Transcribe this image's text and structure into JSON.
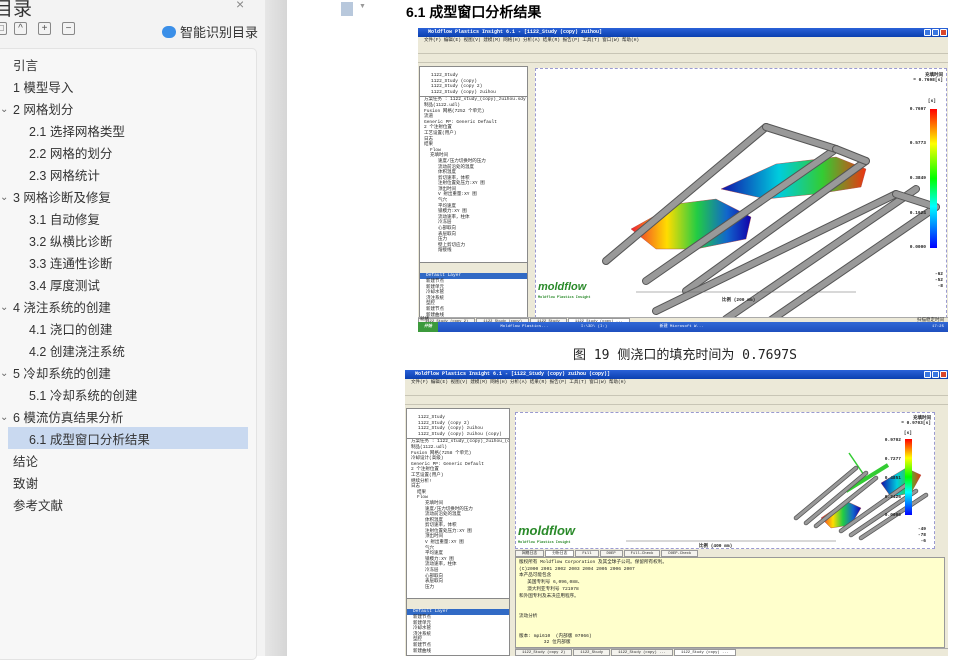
{
  "toc": {
    "title": "目录",
    "close_icon": "×",
    "buttons": [
      "expand-all",
      "collapse",
      "add",
      "remove"
    ],
    "button_glyphs": [
      "□",
      "^",
      "+",
      "−"
    ],
    "ai_label": "智能识别目录",
    "items": [
      {
        "label": "引言",
        "level": 1
      },
      {
        "label": "1 模型导入",
        "level": 1
      },
      {
        "label": "2 网格划分",
        "level": 1,
        "expanded": true
      },
      {
        "label": "2.1  选择网格类型",
        "level": 2
      },
      {
        "label": "2.2 网格的划分",
        "level": 2
      },
      {
        "label": "2.3 网格统计",
        "level": 2
      },
      {
        "label": "3 网格诊断及修复",
        "level": 1,
        "expanded": true
      },
      {
        "label": "3.1 自动修复",
        "level": 2
      },
      {
        "label": "3.2 纵横比诊断",
        "level": 2
      },
      {
        "label": "3.3 连通性诊断",
        "level": 2
      },
      {
        "label": "3.4 厚度测试",
        "level": 2
      },
      {
        "label": "4 浇注系统的创建",
        "level": 1,
        "expanded": true
      },
      {
        "label": "4.1 浇口的创建",
        "level": 2
      },
      {
        "label": "4.2 创建浇注系统",
        "level": 2
      },
      {
        "label": "5 冷却系统的创建",
        "level": 1,
        "expanded": true
      },
      {
        "label": "5.1 冷却系统的创建",
        "level": 2
      },
      {
        "label": "6 模流仿真结果分析",
        "level": 1,
        "expanded": true
      },
      {
        "label": "6.1 成型窗口分析结果",
        "level": 2,
        "selected": true
      },
      {
        "label": "结论",
        "level": 1
      },
      {
        "label": "致谢",
        "level": 1
      },
      {
        "label": "参考文献",
        "level": 1
      }
    ],
    "selected_color": "#c9d9f0"
  },
  "document": {
    "heading": "6.1 成型窗口分析结果",
    "caption1": "图 19 侧浇口的填充时间为 0.7697S",
    "figure1": {
      "title": "Moldflow Plastics Insight 6.1 - [1122_Study (copy) zuihou]",
      "menu": "文件(F)  编辑(E)  视图(V)  建模(M)  网格(H)  分析(A)  结果(R)  报告(P)  工具(T)  窗口(W)  帮助(H)",
      "studies": [
        "1122_Study",
        "1122_Study (copy)",
        "1122_Study (copy 2)",
        "1122_Study (copy) zuihou"
      ],
      "tree": [
        "方案任务 : 1122_study_(copy)_zuihou.sdy",
        "制品(1122.udl)",
        "Fusion 网格(7252 个单元)",
        "流道",
        "Generic PP: Generic Default",
        "2 个注射位置",
        "工艺设置(用户)",
        "日志",
        "结果",
        "Flow",
        "充填时间",
        "速度/压力切换时的压力",
        "流动前沿处的温度",
        "体积温度",
        "剪切速率，体积",
        "注射位置处压力:XY 图",
        "顶出时间",
        "V 射出重量:XY 图",
        "气穴",
        "平均速度",
        "锁模力:XY 图",
        "流动速率，柱体",
        "冷冻层",
        "心部取向",
        "表层取向",
        "压力",
        "壁上剪切应力",
        "熔接线"
      ],
      "layers": [
        "Default Layer",
        "新建节点",
        "新建单元",
        "冷却水管",
        "浇注系统",
        "型腔",
        "新建节点",
        "新建曲线"
      ],
      "result_name": "充填时间",
      "result_value": "= 0.7698[s]",
      "unit": "[s]",
      "legend": [
        "0.7697",
        "0.5773",
        "0.3849",
        "0.1924",
        "0.0000"
      ],
      "scale": "比例 (200 mm)",
      "axis_values": [
        "-62",
        "-52",
        "-8"
      ],
      "logo": "moldflow",
      "logo_sub": "Moldflow Plastics Insight",
      "tabs": [
        "1122_Study (copy 2)",
        "1122_Study (copy)",
        "1122_Study",
        "1122_Study (copy) ..."
      ],
      "status": "就绪",
      "status_right": "扫描稳定时间",
      "taskbar": [
        "开始",
        "Moldflow Plastics...",
        "I:\\3D\\ (I:)",
        "新建 Microsoft W..."
      ],
      "clock": "17:25"
    },
    "figure2": {
      "title": "Moldflow Plastics Insight 6.1 - [1122_Study (copy) zuihou (copy)]",
      "menu": "文件(F)  编辑(E)  视图(V)  建模(M)  网格(H)  分析(A)  结果(R)  报告(P)  工具(T)  窗口(W)  帮助(H)",
      "studies": [
        "1122_Study",
        "1122_Study (copy 2)",
        "1122_Study (copy) zuihou",
        "1122_Study (copy) zuihou (copy)"
      ],
      "tree": [
        "方案任务 : 1122_study_(copy)_zuihou_(c",
        "制品(1122.udl)",
        "Fusion 网格(7258 个单元)",
        "冷却设计(高级)",
        "Generic PP: Generic Default",
        "2 个注射位置",
        "工艺设置(用户)",
        "继续分析!",
        "日志",
        "结果",
        "Flow",
        "充填时间",
        "速度/压力切换时的压力",
        "流动前沿处的温度",
        "体积温度",
        "剪切速率，体积",
        "注射位置处压力:XY 图",
        "顶出时间",
        "V 射出重量:XY 图",
        "气穴",
        "平均速度",
        "锁模力:XY 图",
        "流动速率，柱体",
        "冷冻层",
        "心部取向",
        "表层取向",
        "压力"
      ],
      "layers": [
        "Default Layer",
        "新建节点",
        "新建单元",
        "冷却水管",
        "浇注系统",
        "型腔",
        "新建节点",
        "新建曲线"
      ],
      "result_name": "充填时间",
      "result_value": "= 0.9703[s]",
      "unit": "[s]",
      "legend": [
        "0.9702",
        "0.7277",
        "0.4851",
        "0.2426",
        "0.0000"
      ],
      "scale": "比例 (400 mm)",
      "axis_values": [
        "-49",
        "-78",
        "-6"
      ],
      "logo": "moldflow",
      "logo_sub": "Moldflow Plastics Insight",
      "log_tabs": [
        "网格日志",
        "分析日志",
        "Fill",
        "DOEP",
        "Fill-Check",
        "DOEP-Check"
      ],
      "log_text": "版权所有 Moldflow Corporation 及其全球子公司。保留所有权利。\n(C)2000 2001 2002 2003 2004 2005 2006 2007\n本产品可能包含\n   美国专利号 6,096,088、\n   澳大利亚专利号 721978\n和外国专利及未决应用程序。\n\n\n流动分析\n\n\n版本: mpi610  (内部版 07066)\n         32 位内部版",
      "tabs": [
        "1122_Study (copy 2)",
        "1122_Study",
        "1122_Study (copy) ...",
        "1122_Study (copy) ..."
      ]
    }
  }
}
